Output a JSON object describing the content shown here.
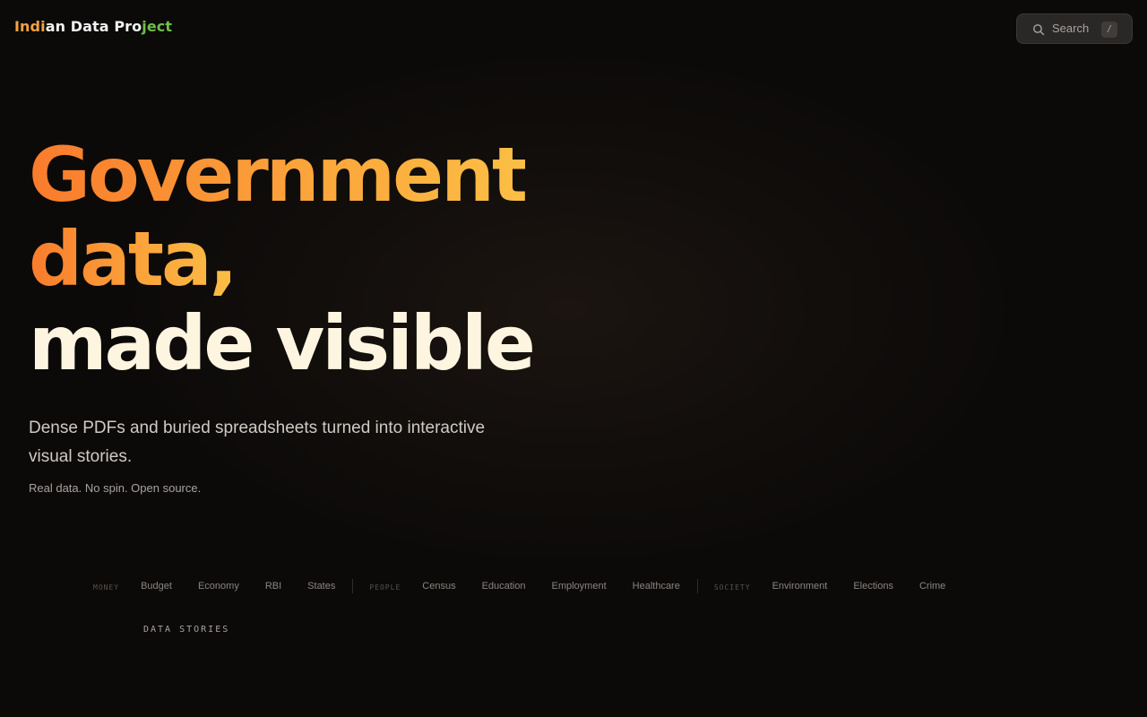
{
  "brand": {
    "part1": "Indi",
    "part2": "an Data Pro",
    "part3": "ject"
  },
  "search": {
    "label": "Search",
    "shortcut": "/"
  },
  "hero": {
    "title_line1": "Government",
    "title_line2": "data,",
    "title_line3": "made visible",
    "subtitle": "Dense PDFs and buried spreadsheets turned into interactive visual stories.",
    "tagline": "Real data. No spin. Open source."
  },
  "topics": {
    "money": {
      "label": "MONEY",
      "items": [
        "Budget",
        "Economy",
        "RBI",
        "States"
      ]
    },
    "people": {
      "label": "PEOPLE",
      "items": [
        "Census",
        "Education",
        "Employment",
        "Healthcare"
      ]
    },
    "society": {
      "label": "SOCIETY",
      "items": [
        "Environment",
        "Elections",
        "Crime"
      ]
    }
  },
  "section": {
    "label": "DATA STORIES"
  },
  "colors": {
    "background": "#0c0a09",
    "accent_orange": "#f97b2c",
    "accent_amber": "#fbbf45",
    "accent_green": "#6fbf4a",
    "text_light": "#fdf5e0"
  }
}
